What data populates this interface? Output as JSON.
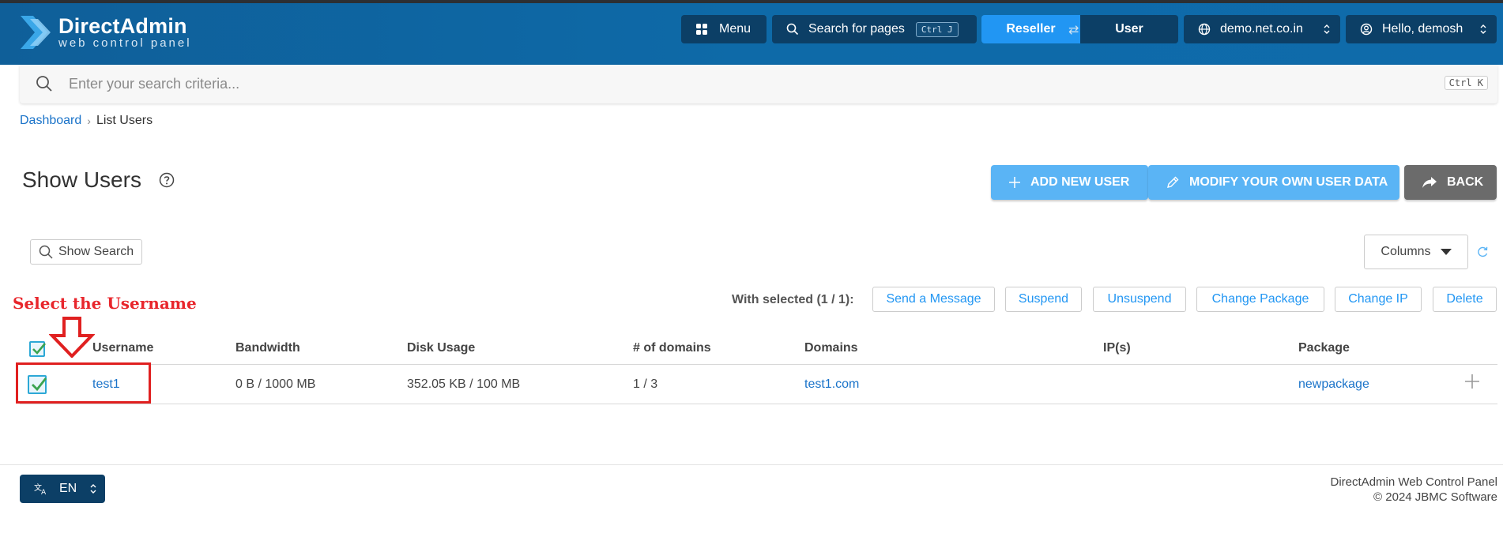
{
  "brand": {
    "title": "DirectAdmin",
    "subtitle": "web control panel"
  },
  "header": {
    "menu_label": "Menu",
    "search_pages_label": "Search for pages",
    "search_pages_shortcut": "Ctrl J",
    "mode_reseller": "Reseller",
    "mode_user": "User",
    "domain": "demo.net.co.in",
    "greeting": "Hello, demosh"
  },
  "search": {
    "placeholder": "Enter your search criteria...",
    "shortcut": "Ctrl K"
  },
  "breadcrumb": {
    "items": [
      "Dashboard",
      "List Users"
    ]
  },
  "page": {
    "title": "Show Users"
  },
  "actions": {
    "add_user": "ADD NEW USER",
    "modify_data": "MODIFY YOUR OWN USER DATA",
    "back": "BACK"
  },
  "toolbar": {
    "show_search": "Show Search",
    "columns": "Columns",
    "with_selected": "With selected (1 / 1):",
    "bulk": [
      "Send a Message",
      "Suspend",
      "Unsuspend",
      "Change Package",
      "Change IP",
      "Delete"
    ]
  },
  "annotation": {
    "text": "Select the Username"
  },
  "table": {
    "columns": [
      "Username",
      "Bandwidth",
      "Disk Usage",
      "# of domains",
      "Domains",
      "IP(s)",
      "Package"
    ],
    "rows": [
      {
        "username": "test1",
        "bandwidth": "0 B / 1000 MB",
        "disk_usage": "352.05 KB / 100 MB",
        "domains_count": "1 / 3",
        "domain": "test1.com",
        "ips": "",
        "package": "newpackage",
        "selected": true
      }
    ]
  },
  "footer": {
    "language": "EN",
    "line1": "DirectAdmin Web Control Panel",
    "line2": "© 2024 JBMC Software"
  },
  "colors": {
    "header_bg": "#0e6aa8",
    "header_button_bg": "#0c3f66",
    "accent": "#2196f3",
    "light_button": "#5ab4f5",
    "back_button": "#6b6b6b",
    "link": "#1a73c9",
    "annotation_red": "#e8262c"
  }
}
